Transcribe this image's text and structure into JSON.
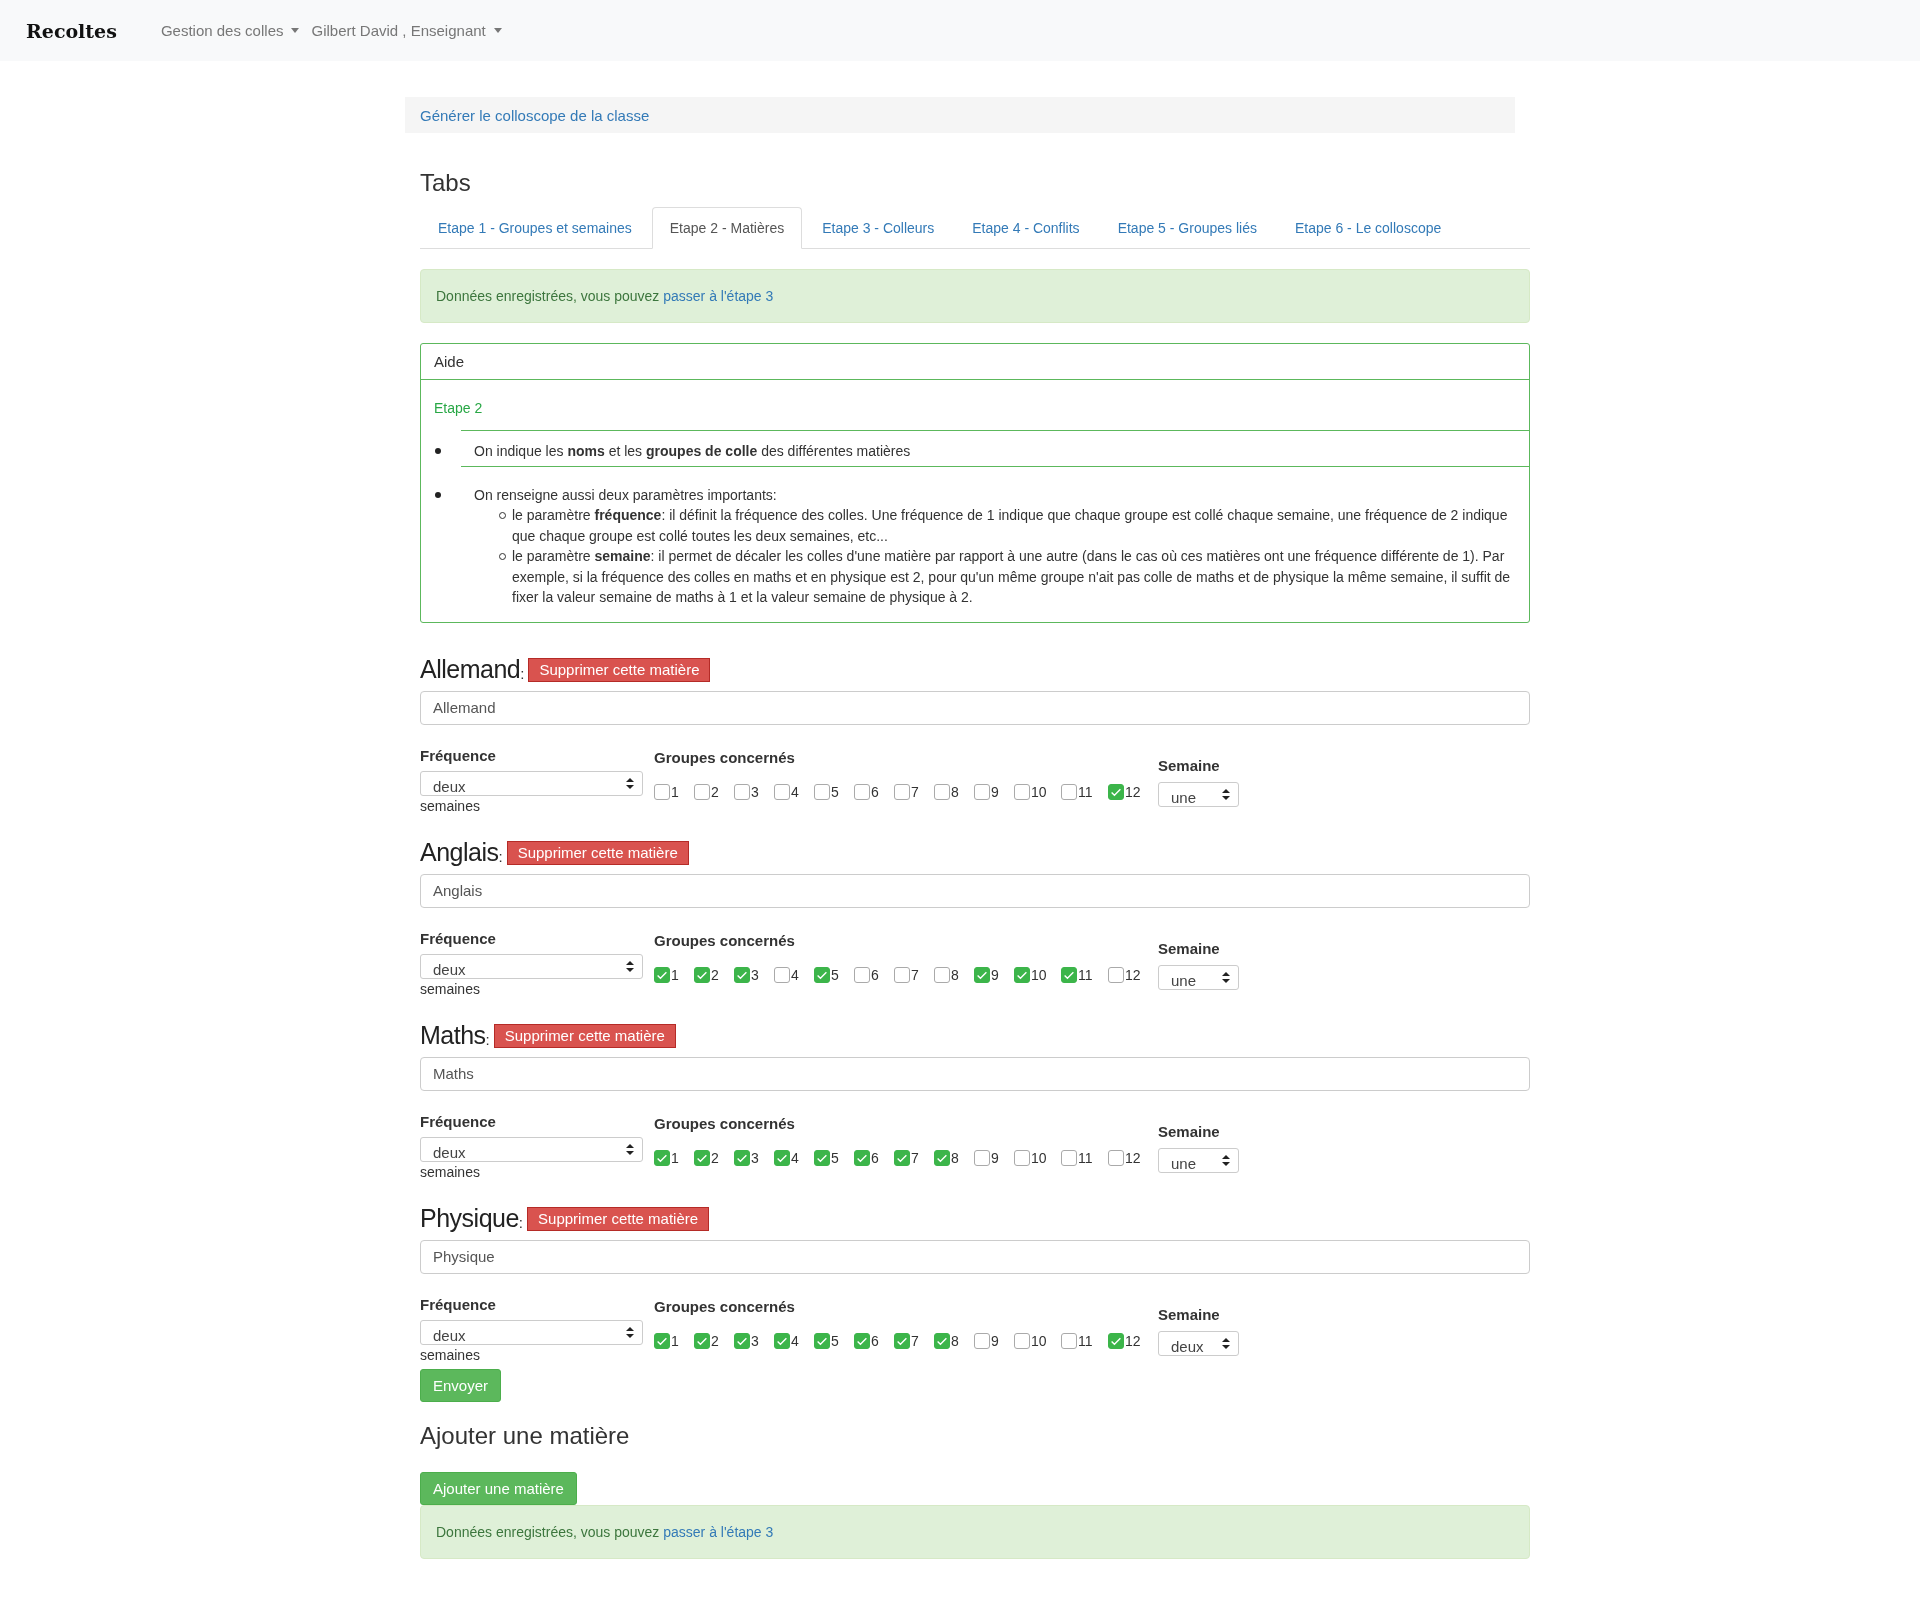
{
  "navbar": {
    "brand": "Recoltes",
    "menus": [
      {
        "label": "Gestion des colles"
      },
      {
        "label": "Gilbert David , Enseignant"
      }
    ]
  },
  "breadcrumb": {
    "link": "Générer le colloscope de la classe"
  },
  "tabs_title": "Tabs",
  "tabs": [
    {
      "label": "Etape 1 - Groupes et semaines",
      "selected": false
    },
    {
      "label": "Etape 2 - Matières",
      "selected": true
    },
    {
      "label": "Etape 3 - Colleurs",
      "selected": false
    },
    {
      "label": "Etape 4 - Conflits",
      "selected": false
    },
    {
      "label": "Etape 5 - Groupes liés",
      "selected": false
    },
    {
      "label": "Etape 6 - Le colloscope",
      "selected": false
    }
  ],
  "alert_top": {
    "text": "Données enregistrées, vous pouvez",
    "link": "passer à l'étape 3"
  },
  "help": {
    "title": "Aide",
    "subtitle": "Etape 2",
    "items": [
      {
        "text": "On indique les **noms** et les **groupes de colle** des différentes matières"
      },
      {
        "text": "On renseigne aussi deux paramètres importants:",
        "children": [
          {
            "text": "le paramètre **fréquence**: il définit la fréquence des colles. Une fréquence de 1 indique que chaque groupe est collé chaque semaine, une fréquence de 2 indique que chaque groupe est collé toutes les deux semaines, etc..."
          },
          {
            "text": "le paramètre **semaine**: il permet de décaler les colles d'une matière par rapport à une autre (dans le cas où ces matières ont une fréquence différente de 1). Par exemple, si la fréquence des colles en maths et en physique est 2, pour qu'un même groupe n'ait pas colle de maths et de physique la même semaine, il suffit de fixer la valeur semaine de maths à 1 et la valeur semaine de physique à 2."
          }
        ]
      }
    ]
  },
  "subjects": [
    {
      "title": "Allemand",
      "colon": ":",
      "delete_button": "Supprimer cette matière",
      "name_value": "Allemand",
      "frequency_label": "Fréquence",
      "frequency_value": "deux",
      "frequency_suffix": "semaines",
      "groups_label": "Groupes concernés",
      "week_label": "Semaine",
      "week_value": "une",
      "groups": [
        {
          "label": "1",
          "checked": false
        },
        {
          "label": "2",
          "checked": false
        },
        {
          "label": "3",
          "checked": false
        },
        {
          "label": "4",
          "checked": false
        },
        {
          "label": "5",
          "checked": false
        },
        {
          "label": "6",
          "checked": false
        },
        {
          "label": "7",
          "checked": false
        },
        {
          "label": "8",
          "checked": false
        },
        {
          "label": "9",
          "checked": false
        },
        {
          "label": "10",
          "checked": false
        },
        {
          "label": "11",
          "checked": false
        },
        {
          "label": "12",
          "checked": true
        }
      ]
    },
    {
      "title": "Anglais",
      "colon": ":",
      "delete_button": "Supprimer cette matière",
      "name_value": "Anglais",
      "frequency_label": "Fréquence",
      "frequency_value": "deux",
      "frequency_suffix": "semaines",
      "groups_label": "Groupes concernés",
      "week_label": "Semaine",
      "week_value": "une",
      "groups": [
        {
          "label": "1",
          "checked": true
        },
        {
          "label": "2",
          "checked": true
        },
        {
          "label": "3",
          "checked": true
        },
        {
          "label": "4",
          "checked": false
        },
        {
          "label": "5",
          "checked": true
        },
        {
          "label": "6",
          "checked": false
        },
        {
          "label": "7",
          "checked": false
        },
        {
          "label": "8",
          "checked": false
        },
        {
          "label": "9",
          "checked": true
        },
        {
          "label": "10",
          "checked": true
        },
        {
          "label": "11",
          "checked": true
        },
        {
          "label": "12",
          "checked": false
        }
      ]
    },
    {
      "title": "Maths",
      "colon": ":",
      "delete_button": "Supprimer cette matière",
      "name_value": "Maths",
      "frequency_label": "Fréquence",
      "frequency_value": "deux",
      "frequency_suffix": "semaines",
      "groups_label": "Groupes concernés",
      "week_label": "Semaine",
      "week_value": "une",
      "groups": [
        {
          "label": "1",
          "checked": true
        },
        {
          "label": "2",
          "checked": true
        },
        {
          "label": "3",
          "checked": true
        },
        {
          "label": "4",
          "checked": true
        },
        {
          "label": "5",
          "checked": true
        },
        {
          "label": "6",
          "checked": true
        },
        {
          "label": "7",
          "checked": true
        },
        {
          "label": "8",
          "checked": true
        },
        {
          "label": "9",
          "checked": false
        },
        {
          "label": "10",
          "checked": false
        },
        {
          "label": "11",
          "checked": false
        },
        {
          "label": "12",
          "checked": false
        }
      ]
    },
    {
      "title": "Physique",
      "colon": ":",
      "delete_button": "Supprimer cette matière",
      "name_value": "Physique",
      "frequency_label": "Fréquence",
      "frequency_value": "deux",
      "frequency_suffix": "semaines",
      "groups_label": "Groupes concernés",
      "week_label": "Semaine",
      "week_value": "deux",
      "groups": [
        {
          "label": "1",
          "checked": true
        },
        {
          "label": "2",
          "checked": true
        },
        {
          "label": "3",
          "checked": true
        },
        {
          "label": "4",
          "checked": true
        },
        {
          "label": "5",
          "checked": true
        },
        {
          "label": "6",
          "checked": true
        },
        {
          "label": "7",
          "checked": true
        },
        {
          "label": "8",
          "checked": true
        },
        {
          "label": "9",
          "checked": false
        },
        {
          "label": "10",
          "checked": false
        },
        {
          "label": "11",
          "checked": false
        },
        {
          "label": "12",
          "checked": true
        }
      ]
    }
  ],
  "submit_button": "Envoyer",
  "add_title": "Ajouter une matière",
  "add_button": "Ajouter une matière",
  "alert_bottom": {
    "text": "Données enregistrées, vous pouvez",
    "link": "passer à l'étape 3"
  }
}
